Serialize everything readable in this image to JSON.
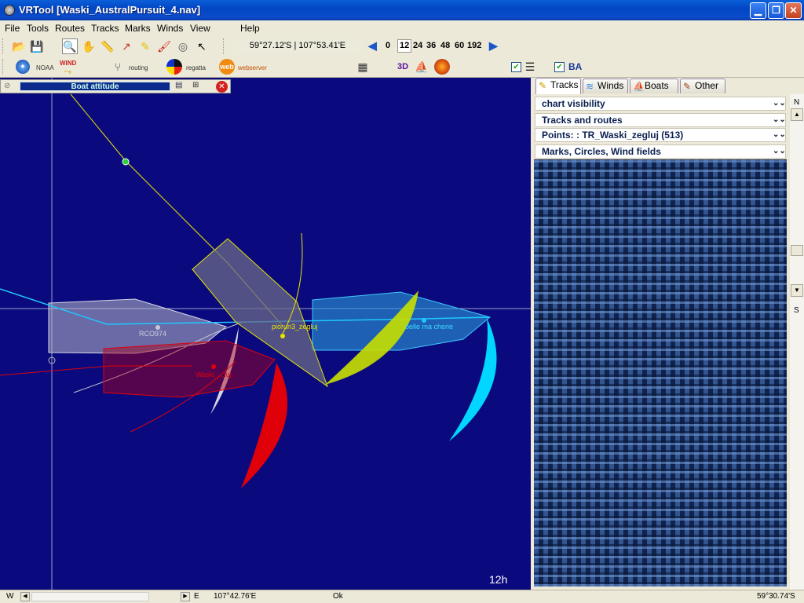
{
  "window": {
    "title": "VRTool [Waski_AustralPursuit_4.nav]"
  },
  "menu": [
    "File",
    "Tools",
    "Routes",
    "Tracks",
    "Marks",
    "Winds",
    "View",
    "Help"
  ],
  "toolbar": {
    "coordinates": "59°27.12'S | 107°53.41'E",
    "time_steps": [
      "0",
      "12",
      "24",
      "36",
      "48",
      "60",
      "192"
    ],
    "selected_step": "12"
  },
  "toolbar2": {
    "noaa": "NOAA",
    "wind": "WIND",
    "routing": "routing",
    "regatta": "regatta",
    "web": "web",
    "webserver": "webserver",
    "threed": "3D",
    "ba": "BA"
  },
  "boat_attitude": {
    "title": "Boat attitude"
  },
  "map": {
    "boats": [
      {
        "name": "RCO974",
        "color": "#b9b9c9"
      },
      {
        "name": "piorun3_zegluj",
        "color": "#e6e600"
      },
      {
        "name": "belle ma cherie",
        "color": "#00d6ff"
      },
      {
        "name": "Waski_zegluj",
        "label": "Waski_...luj",
        "color": "#e0000a"
      }
    ],
    "time_label": "12h"
  },
  "panel": {
    "tabs": [
      "Tracks",
      "Winds",
      "Boats",
      "Other"
    ],
    "sections": [
      "chart visibility",
      "Tracks and routes",
      "Points: : TR_Waski_zegluj (513)",
      "Marks, Circles, Wind fields"
    ]
  },
  "scroll": {
    "north": "N",
    "south": "S"
  },
  "status": {
    "west": "W",
    "east": "E",
    "longitude": "107°42.76'E",
    "message": "Ok",
    "latitude": "59°30.74'S"
  }
}
